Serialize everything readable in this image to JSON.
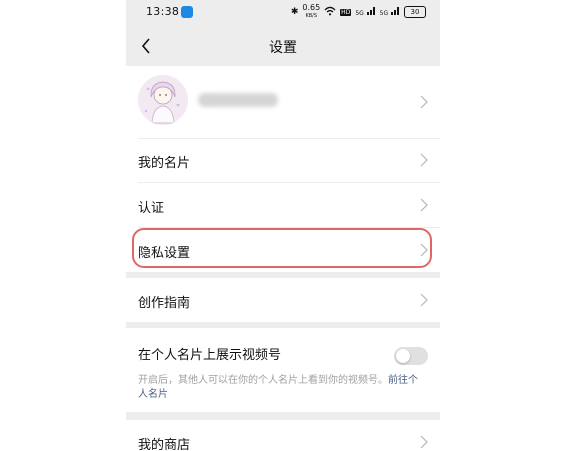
{
  "status_bar": {
    "time": "13:38",
    "network_speed": "0.65",
    "network_unit": "KB/S",
    "signal_1": "5G",
    "signal_2": "5G",
    "battery": "30"
  },
  "nav": {
    "title": "设置"
  },
  "menu": {
    "my_card": "我的名片",
    "verify": "认证",
    "privacy": "隐私设置",
    "creator_guide": "创作指南",
    "show_channels_label": "在个人名片上展示视频号",
    "show_channels_desc": "开启后，其他人可以在你的个人名片上看到你的视频号。",
    "show_channels_desc_link": "前往个人名片",
    "my_shop": "我的商店"
  },
  "toggles": {
    "show_channels_on": false
  },
  "colors": {
    "background": "#ededed",
    "highlight_border": "#e06666",
    "link": "#4b5f85"
  }
}
